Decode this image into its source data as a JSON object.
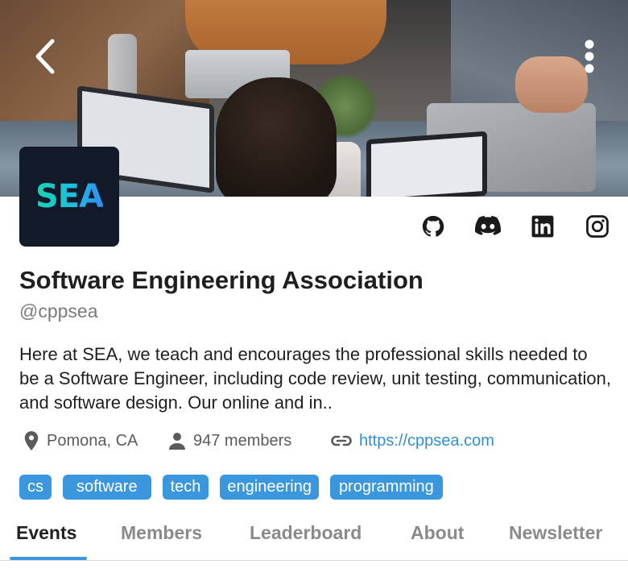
{
  "header": {
    "back_icon": "chevron-left-icon",
    "menu_icon": "more-vertical-icon"
  },
  "logo": {
    "text": "SEA"
  },
  "socials": [
    {
      "icon": "github-icon"
    },
    {
      "icon": "discord-icon"
    },
    {
      "icon": "linkedin-icon"
    },
    {
      "icon": "instagram-icon"
    }
  ],
  "profile": {
    "name": "Software Engineering Association",
    "handle": "@cppsea",
    "description": "Here at SEA, we teach and encourages the professional skills needed to be a Software Engineer, including code review, unit testing, communication, and software design. Our online and in.."
  },
  "meta": {
    "location": "Pomona, CA",
    "members": "947 members",
    "website": "https://cppsea.com"
  },
  "tags": [
    "cs",
    "software",
    "tech",
    "engineering",
    "programming"
  ],
  "tabs": [
    {
      "label": "Events",
      "active": true
    },
    {
      "label": "Members",
      "active": false
    },
    {
      "label": "Leaderboard",
      "active": false
    },
    {
      "label": "About",
      "active": false
    },
    {
      "label": "Newsletter",
      "active": false
    }
  ],
  "colors": {
    "accent": "#3a96dd",
    "link": "#2f8fd6",
    "logo_bg": "#121a2a"
  }
}
